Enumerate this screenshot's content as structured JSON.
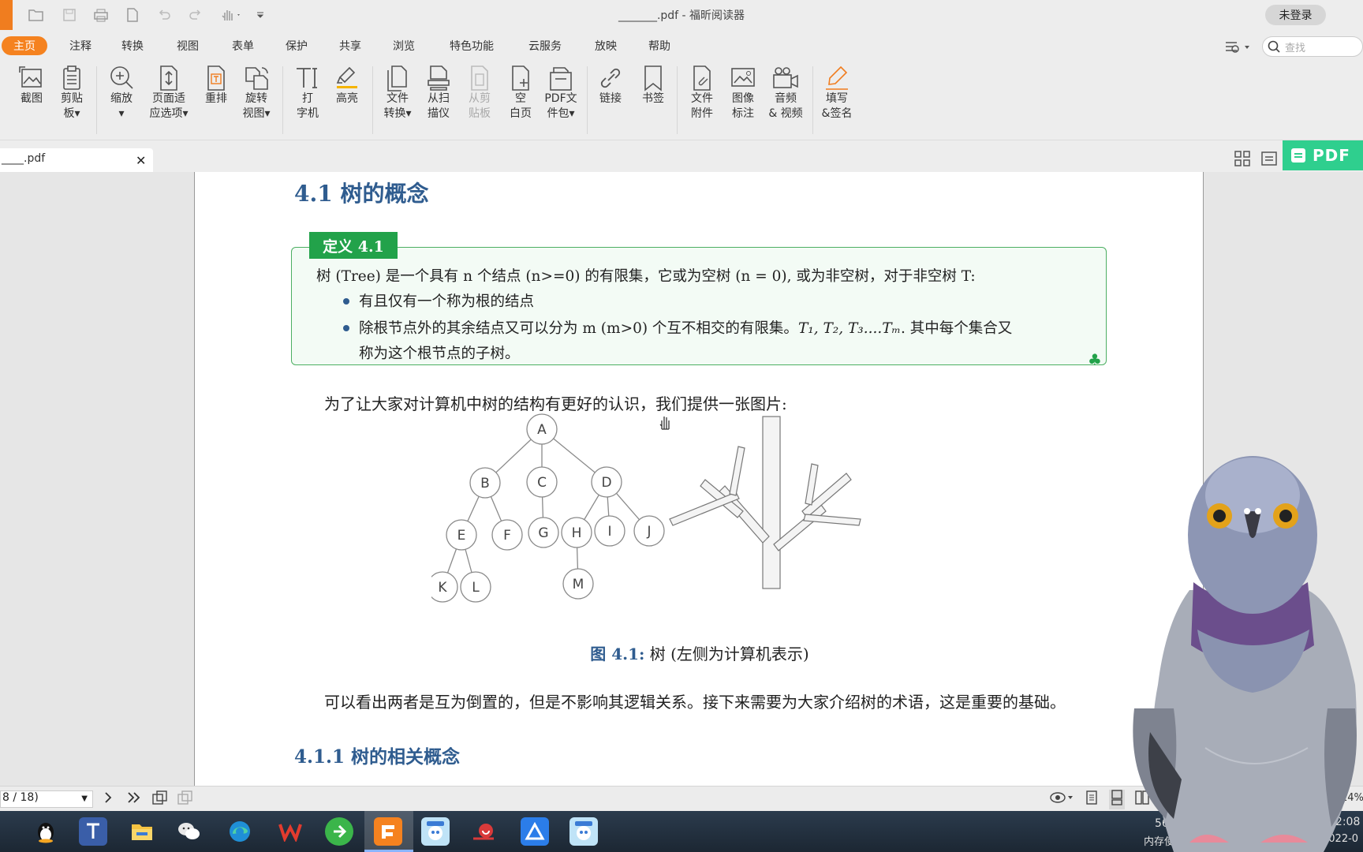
{
  "window": {
    "title": "_______.pdf - 福昕阅读器",
    "login_label": "未登录"
  },
  "colors": {
    "accent": "#f5821f",
    "heading": "#2f5c8f",
    "definition_green": "#22a24a",
    "pdf_banner": "#2fcf8e"
  },
  "menu": {
    "tabs": [
      "主页",
      "注释",
      "转换",
      "视图",
      "表单",
      "保护",
      "共享",
      "浏览",
      "特色功能",
      "云服务",
      "放映",
      "帮助"
    ],
    "active_tab": "主页"
  },
  "search": {
    "placeholder": "查找"
  },
  "toolbar": {
    "screenshot": {
      "line1": "截图"
    },
    "clipboard": {
      "line1": "剪贴",
      "line2": "板▾"
    },
    "zoom": {
      "line1": "缩放",
      "line2": "▾"
    },
    "page_fit": {
      "line1": "页面适",
      "line2": "应选项▾"
    },
    "reflow": {
      "line1": "重排"
    },
    "rotate": {
      "line1": "旋转",
      "line2": "视图▾"
    },
    "typewriter": {
      "line1": "打",
      "line2": "字机"
    },
    "highlight": {
      "line1": "高亮"
    },
    "file_convert": {
      "line1": "文件",
      "line2": "转换▾"
    },
    "from_scanner": {
      "line1": "从扫",
      "line2": "描仪"
    },
    "from_clipboard": {
      "line1": "从剪",
      "line2": "贴板"
    },
    "blank_page": {
      "line1": "空",
      "line2": "白页"
    },
    "pdf_package": {
      "line1": "PDF文",
      "line2": "件包▾"
    },
    "link": {
      "line1": "链接"
    },
    "bookmark": {
      "line1": "书签"
    },
    "file_attachment": {
      "line1": "文件",
      "line2": "附件"
    },
    "image_annotation": {
      "line1": "图像",
      "line2": "标注"
    },
    "audio_video": {
      "line1": "音频",
      "line2": "& 视频"
    },
    "fill_sign": {
      "line1": "填写",
      "line2": "&签名"
    }
  },
  "tab": {
    "name": "____.pdf",
    "close": "✕"
  },
  "pdf_banner": {
    "text": "PDF"
  },
  "document": {
    "section_title": "4.1   树的概念",
    "definition": {
      "label": "定义 4.1",
      "line1": "树 (Tree) 是一个具有 n 个结点 (n>=0) 的有限集，它或为空树 (n = 0), 或为非空树，对于非空树 T:",
      "bullet1": "有且仅有一个称为根的结点",
      "bullet2a": "除根节点外的其余结点又可以分为 m (m>0) 个互不相交的有限集。",
      "bullet2_math": "T₁, T₂, T₃....Tₘ",
      "bullet2b": ". 其中每个集合又",
      "bullet2c": "称为这个根节点的子树。",
      "end_mark": "♣"
    },
    "intro": "为了让大家对计算机中树的结构有更好的认识，我们提供一张图片:",
    "figure": {
      "nodes": [
        "A",
        "B",
        "C",
        "D",
        "E",
        "F",
        "G",
        "H",
        "I",
        "J",
        "K",
        "L",
        "M"
      ],
      "edges": [
        [
          "A",
          "B"
        ],
        [
          "A",
          "C"
        ],
        [
          "A",
          "D"
        ],
        [
          "B",
          "E"
        ],
        [
          "B",
          "F"
        ],
        [
          "C",
          "G"
        ],
        [
          "D",
          "H"
        ],
        [
          "D",
          "I"
        ],
        [
          "D",
          "J"
        ],
        [
          "E",
          "K"
        ],
        [
          "E",
          "L"
        ],
        [
          "H",
          "M"
        ]
      ],
      "caption_num": "图 4.1:",
      "caption_text": " 树 (左侧为计算机表示)"
    },
    "after_figure": "可以看出两者是互为倒置的，但是不影响其逻辑关系。接下来需要为大家介绍树的术语，这是重要的基础。",
    "subsection_title": "4.1.1   树的相关概念"
  },
  "status": {
    "page": "8 / 18)",
    "zoom": "14%"
  },
  "taskbar": {
    "mem_pct": "56%",
    "mem_label": "内存使用",
    "time": "22:08",
    "date": "2022-0"
  }
}
